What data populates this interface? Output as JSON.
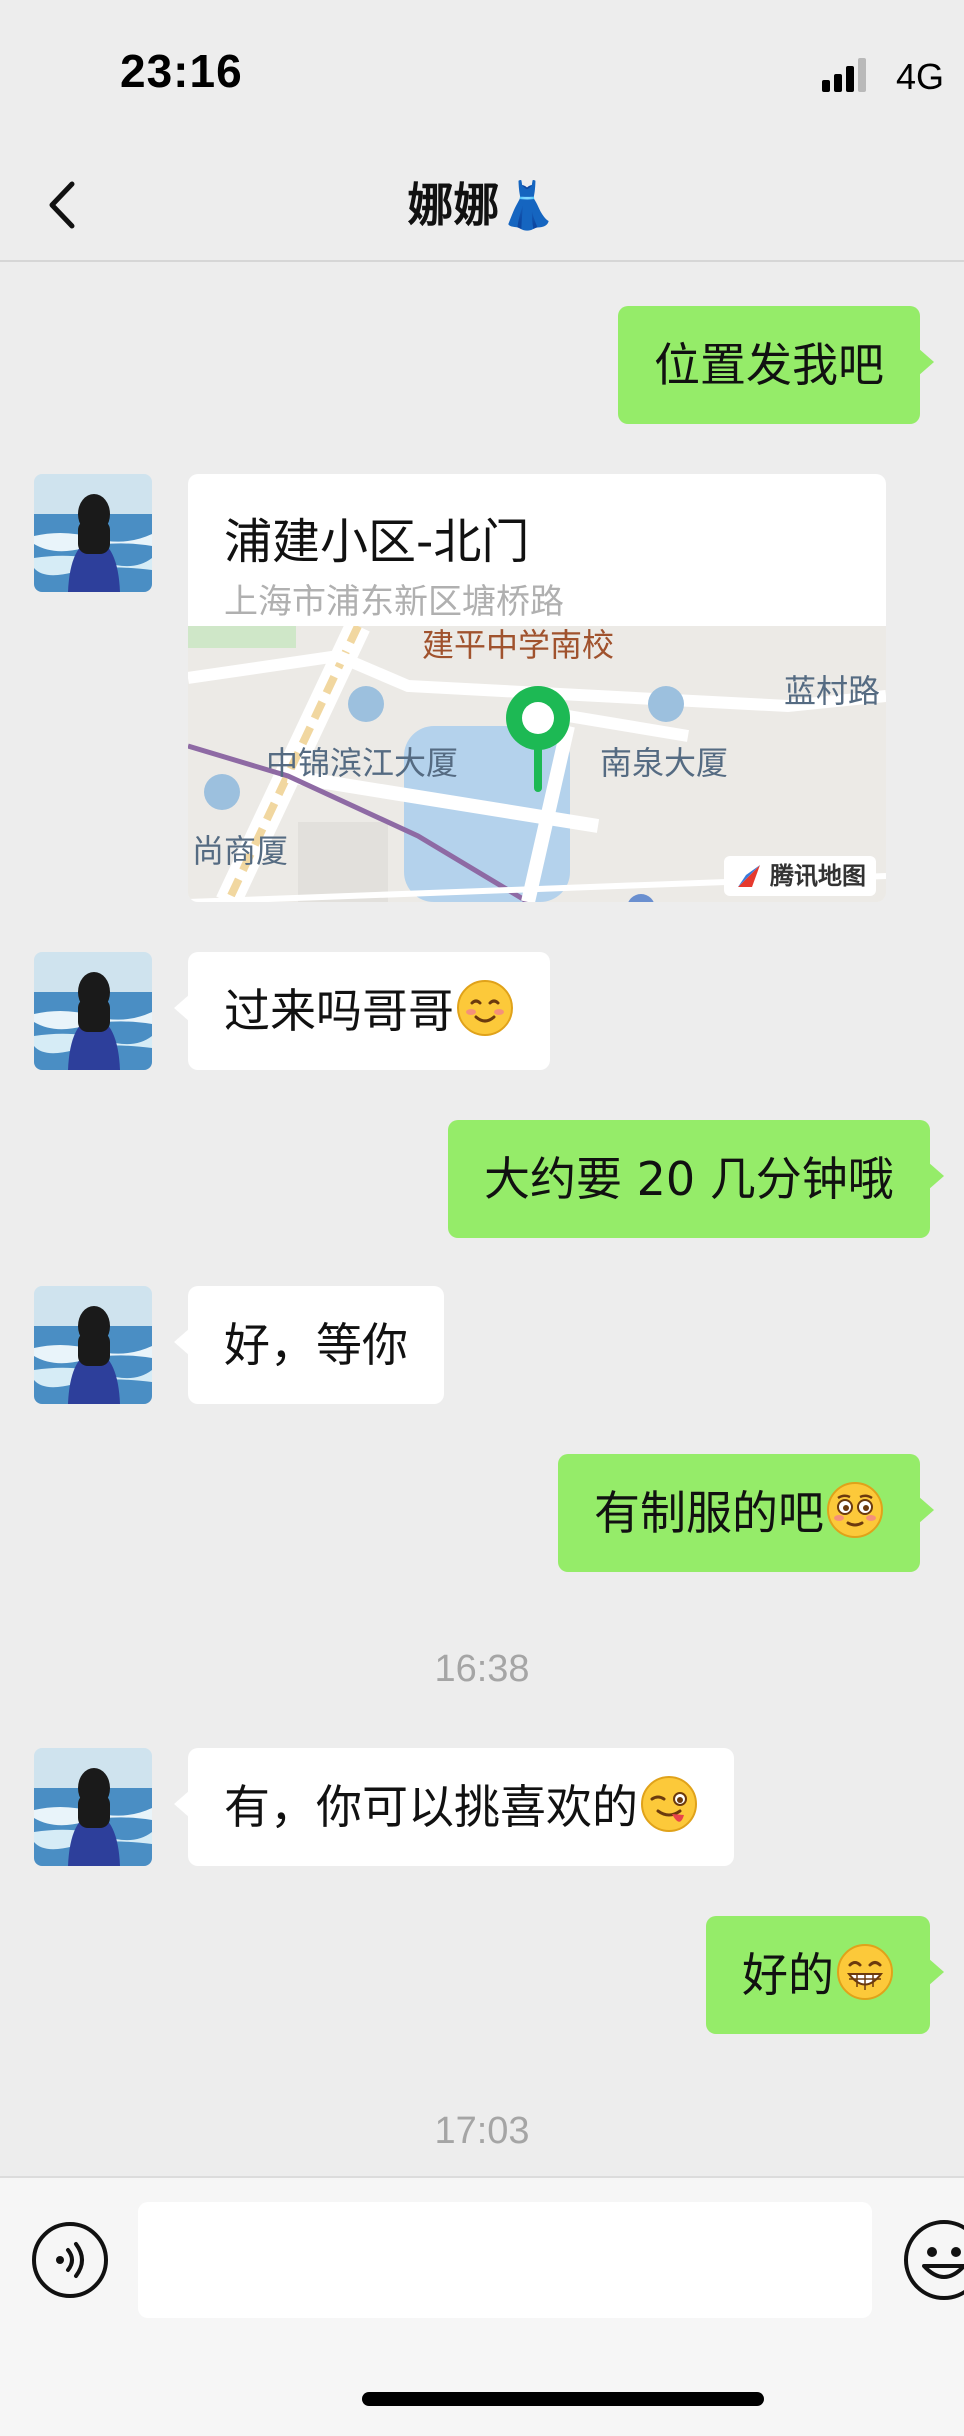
{
  "status_bar": {
    "time": "23:16",
    "network": "4G",
    "signal_bars_active": 3,
    "signal_bars_total": 4
  },
  "nav": {
    "title": "娜娜👗",
    "back_icon": "chevron-left-icon"
  },
  "messages": [
    {
      "side": "out",
      "text": "位置发我吧"
    },
    {
      "side": "in",
      "type": "location",
      "location": {
        "name": "浦建小区-北门",
        "address": "上海市浦东新区塘桥路",
        "map_labels": {
          "school": "建平中学南校",
          "building_left": "中锦滨江大厦",
          "building_right": "南泉大厦",
          "road_right": "蓝村路",
          "building_edge": "尚商厦"
        },
        "map_provider": "腾讯地图"
      }
    },
    {
      "side": "in",
      "text": "过来吗哥哥",
      "emoji": "smiling-blush-emoji"
    },
    {
      "side": "out",
      "text": "大约要 20 几分钟哦"
    },
    {
      "side": "in",
      "text": "好，等你"
    },
    {
      "side": "out",
      "text": "有制服的吧",
      "emoji": "flushed-emoji"
    },
    {
      "side": "in",
      "text": "有，你可以挑喜欢的",
      "emoji": "winking-tongue-emoji"
    },
    {
      "side": "out",
      "text": "好的",
      "emoji": "grinning-emoji"
    }
  ],
  "timestamps": [
    "16:38",
    "17:03"
  ],
  "input_bar": {
    "voice_icon": "voice-icon",
    "emoji_icon": "emoji-icon",
    "input_value": ""
  },
  "colors": {
    "background": "#ededed",
    "outgoing_bubble": "#95ec69",
    "incoming_bubble": "#ffffff",
    "pin": "#1db954",
    "timestamp_text": "#a5a5a5"
  }
}
